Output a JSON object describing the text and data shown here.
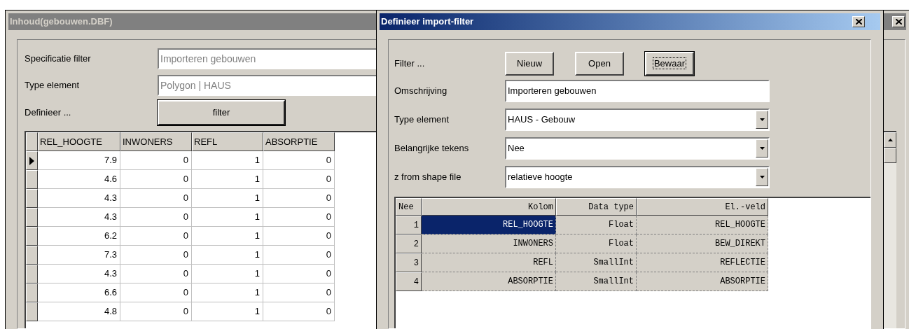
{
  "back_window": {
    "title": "Inhoud(gebouwen.DBF)",
    "fields": [
      {
        "label": "Specificatie filter",
        "value": "Importeren gebouwen",
        "disabled": true
      },
      {
        "label": "Type element",
        "value": "Polygon | HAUS",
        "disabled": true
      }
    ],
    "define_label": "Definieer ...",
    "filter_button": "filter",
    "table": {
      "columns": [
        "REL_HOOGTE",
        "INWONERS",
        "REFL",
        "ABSORPTIE"
      ],
      "rows": [
        {
          "current": true,
          "cells": [
            "7.9",
            "0",
            "1",
            "0"
          ]
        },
        {
          "current": false,
          "cells": [
            "4.6",
            "0",
            "1",
            "0"
          ]
        },
        {
          "current": false,
          "cells": [
            "4.3",
            "0",
            "1",
            "0"
          ]
        },
        {
          "current": false,
          "cells": [
            "4.3",
            "0",
            "1",
            "0"
          ]
        },
        {
          "current": false,
          "cells": [
            "6.2",
            "0",
            "1",
            "0"
          ]
        },
        {
          "current": false,
          "cells": [
            "7.3",
            "0",
            "1",
            "0"
          ]
        },
        {
          "current": false,
          "cells": [
            "4.3",
            "0",
            "1",
            "0"
          ]
        },
        {
          "current": false,
          "cells": [
            "6.6",
            "0",
            "1",
            "0"
          ]
        },
        {
          "current": false,
          "cells": [
            "4.8",
            "0",
            "1",
            "0"
          ]
        }
      ]
    }
  },
  "dialog": {
    "title": "Definieer import-filter",
    "filter_label": "Filter ...",
    "buttons": [
      {
        "label": "Nieuw",
        "focused": false
      },
      {
        "label": "Open",
        "focused": false
      },
      {
        "label": "Bewaar",
        "focused": true
      }
    ],
    "fields": [
      {
        "kind": "text",
        "label": "Omschrijving",
        "value": "Importeren gebouwen"
      },
      {
        "kind": "dropdown",
        "label": "Type element",
        "value": "HAUS - Gebouw"
      },
      {
        "kind": "dropdown",
        "label": "Belangrijke tekens",
        "value": "Nee"
      },
      {
        "kind": "dropdown",
        "label": "z from shape file",
        "value": "relatieve hoogte"
      }
    ],
    "grid": {
      "columns": [
        "Nee",
        "Kolom",
        "Data type",
        "El.-veld"
      ],
      "rows": [
        {
          "cells": [
            {
              "text": "1",
              "selected": false
            },
            {
              "text": "REL_HOOGTE",
              "selected": true
            },
            {
              "text": "Float",
              "selected": false
            },
            {
              "text": "REL_HOOGTE",
              "selected": false
            }
          ]
        },
        {
          "cells": [
            {
              "text": "2",
              "selected": false
            },
            {
              "text": "INWONERS",
              "selected": false
            },
            {
              "text": "Float",
              "selected": false
            },
            {
              "text": "BEW_DIREKT",
              "selected": false
            }
          ]
        },
        {
          "cells": [
            {
              "text": "3",
              "selected": false
            },
            {
              "text": "REFL",
              "selected": false
            },
            {
              "text": "SmallInt",
              "selected": false
            },
            {
              "text": "REFLECTIE",
              "selected": false
            }
          ]
        },
        {
          "cells": [
            {
              "text": "4",
              "selected": false
            },
            {
              "text": "ABSORPTIE",
              "selected": false
            },
            {
              "text": "SmallInt",
              "selected": false
            },
            {
              "text": "ABSORPTIE",
              "selected": false
            }
          ]
        }
      ]
    }
  }
}
